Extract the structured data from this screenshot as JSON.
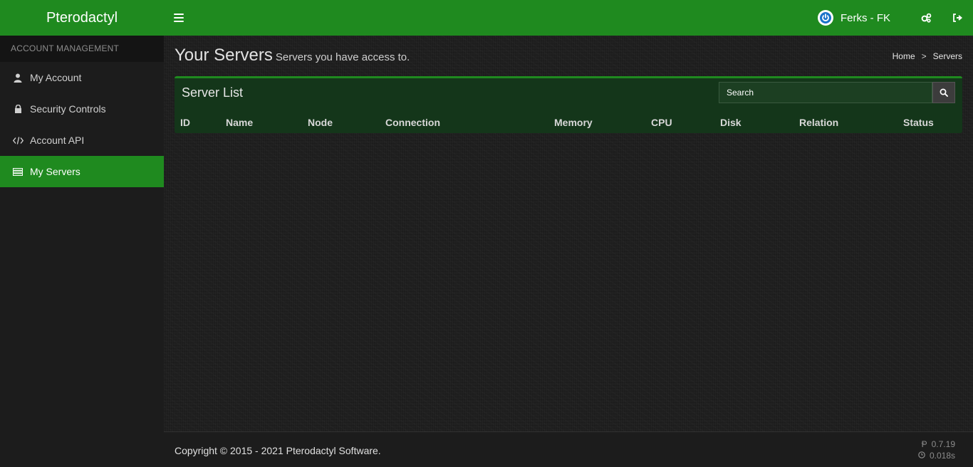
{
  "header": {
    "brand": "Pterodactyl",
    "user_name": "Ferks - FK",
    "accent_color": "#1f8a1f"
  },
  "sidebar": {
    "section_title": "ACCOUNT MANAGEMENT",
    "items": [
      {
        "label": "My Account",
        "icon": "user-icon"
      },
      {
        "label": "Security Controls",
        "icon": "lock-icon"
      },
      {
        "label": "Account API",
        "icon": "code-icon"
      },
      {
        "label": "My Servers",
        "icon": "server-list-icon",
        "active": true
      }
    ]
  },
  "page": {
    "title": "Your Servers",
    "subtitle": "Servers you have access to.",
    "breadcrumb": [
      "Home",
      "Servers"
    ],
    "breadcrumb_sep": ">"
  },
  "server_list": {
    "title": "Server List",
    "search_placeholder": "Search",
    "columns": [
      "ID",
      "Name",
      "Node",
      "Connection",
      "Memory",
      "CPU",
      "Disk",
      "Relation",
      "Status"
    ],
    "rows": []
  },
  "footer": {
    "copyright": "Copyright © 2015 - 2021 Pterodactyl Software.",
    "version": "0.7.19",
    "render_time": "0.018s"
  }
}
